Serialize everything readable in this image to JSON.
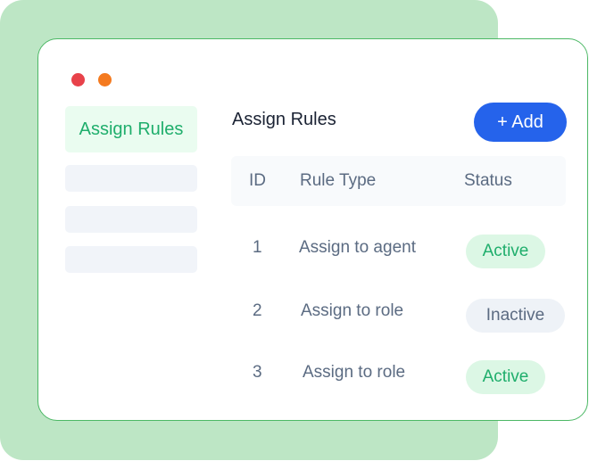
{
  "sidebar": {
    "active_item": "Assign Rules",
    "placeholder_items": 3
  },
  "main": {
    "title": "Assign Rules",
    "add_button": "+ Add"
  },
  "table": {
    "headers": {
      "id": "ID",
      "rule_type": "Rule Type",
      "status": "Status"
    },
    "rows": [
      {
        "id": "1",
        "rule_type": "Assign to agent",
        "status": "Active"
      },
      {
        "id": "2",
        "rule_type": "Assign to role",
        "status": "Inactive"
      },
      {
        "id": "3",
        "rule_type": "Assign to role",
        "status": "Active"
      }
    ]
  },
  "colors": {
    "accent_blue": "#2563eb",
    "active_green": "#1fae6c",
    "backdrop_green": "#bde6c5"
  }
}
